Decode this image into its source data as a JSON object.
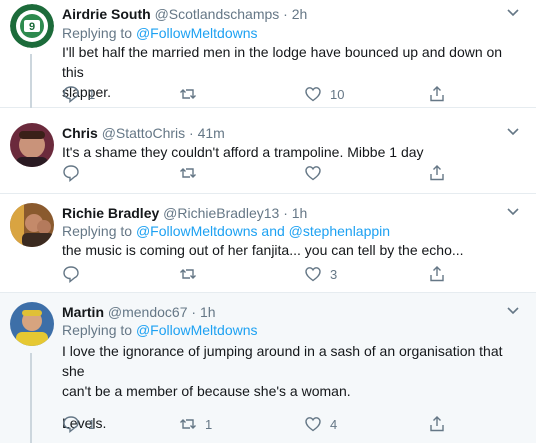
{
  "colors": {
    "accent": "#1da1f2",
    "muted": "#657786",
    "divider": "#e6ecf0",
    "highlight_bg": "#f5f8fa"
  },
  "tweets": [
    {
      "name": "Airdrie South",
      "handle": "@Scotlandschamps",
      "time": "2h",
      "replying_label": "Replying to",
      "replying_to": "@FollowMeltdowns",
      "body_lines": [
        "I'll bet half the married men in the lodge have bounced up and down on this",
        "slapper."
      ],
      "reply_count": "1",
      "retweet_count": "",
      "like_count": "10"
    },
    {
      "name": "Chris",
      "handle": "@StattoChris",
      "time": "41m",
      "body_lines": [
        "It's a shame they couldn't afford a trampoline. Mibbe 1 day"
      ],
      "reply_count": "",
      "retweet_count": "",
      "like_count": ""
    },
    {
      "name": "Richie Bradley",
      "handle": "@RichieBradley13",
      "time": "1h",
      "replying_label": "Replying to",
      "replying_to": "@FollowMeltdowns and @stephenlappin",
      "body_lines": [
        "the music is coming out of her fanjita... you can tell by the echo..."
      ],
      "reply_count": "",
      "retweet_count": "",
      "like_count": "3"
    },
    {
      "name": "Martin",
      "handle": "@mendoc67",
      "time": "1h",
      "replying_label": "Replying to",
      "replying_to": "@FollowMeltdowns",
      "body_lines": [
        "I love the ignorance of jumping around in a sash of an organisation that she",
        "can't be a member of because she's a woman.",
        "",
        "Levels."
      ],
      "reply_count": "1",
      "retweet_count": "1",
      "like_count": "4"
    }
  ],
  "separator_dot": "·"
}
